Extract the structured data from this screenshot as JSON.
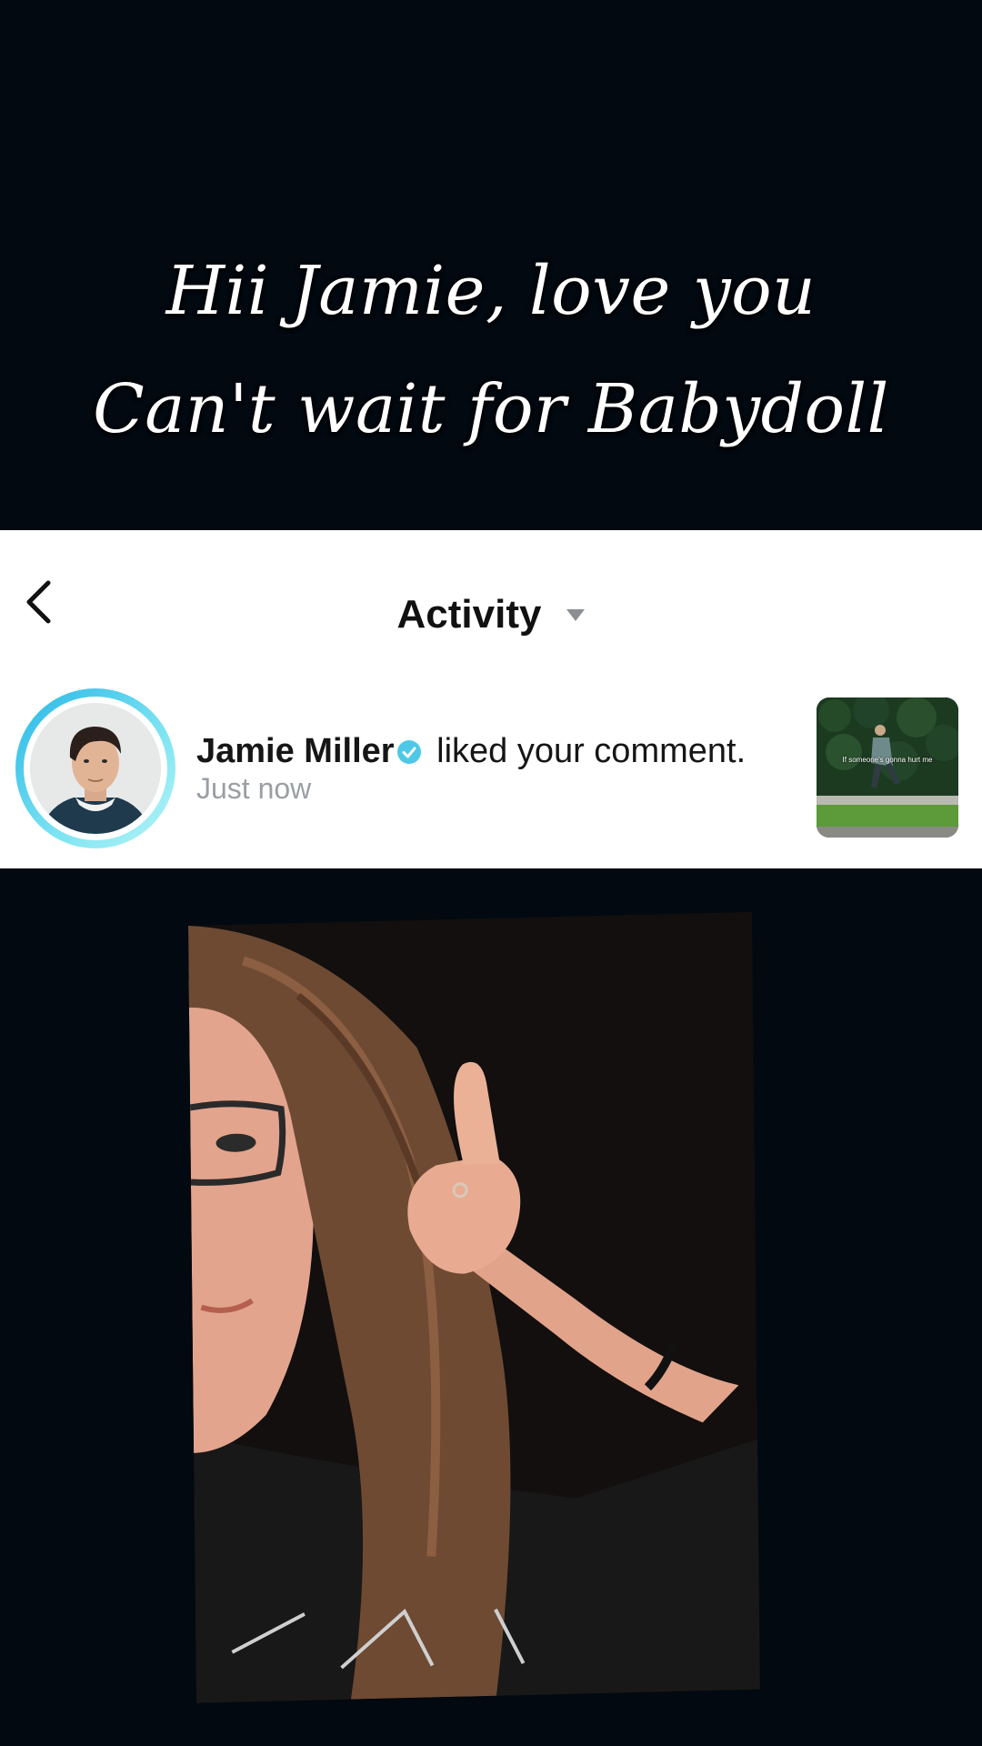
{
  "caption": {
    "line1": "Hii Jamie, love you",
    "line2": "Can't wait for Babydoll"
  },
  "header": {
    "title": "Activity"
  },
  "notification": {
    "username": "Jamie Miller",
    "action": " liked your comment.",
    "timestamp": "Just now",
    "thumbnail_caption": "If someone's gonna hurt me"
  },
  "colors": {
    "background": "#020910",
    "card": "#ffffff",
    "verified": "#4fc8e8",
    "avatar_ring": "#27b7e6",
    "muted_text": "#9a9fa3"
  }
}
